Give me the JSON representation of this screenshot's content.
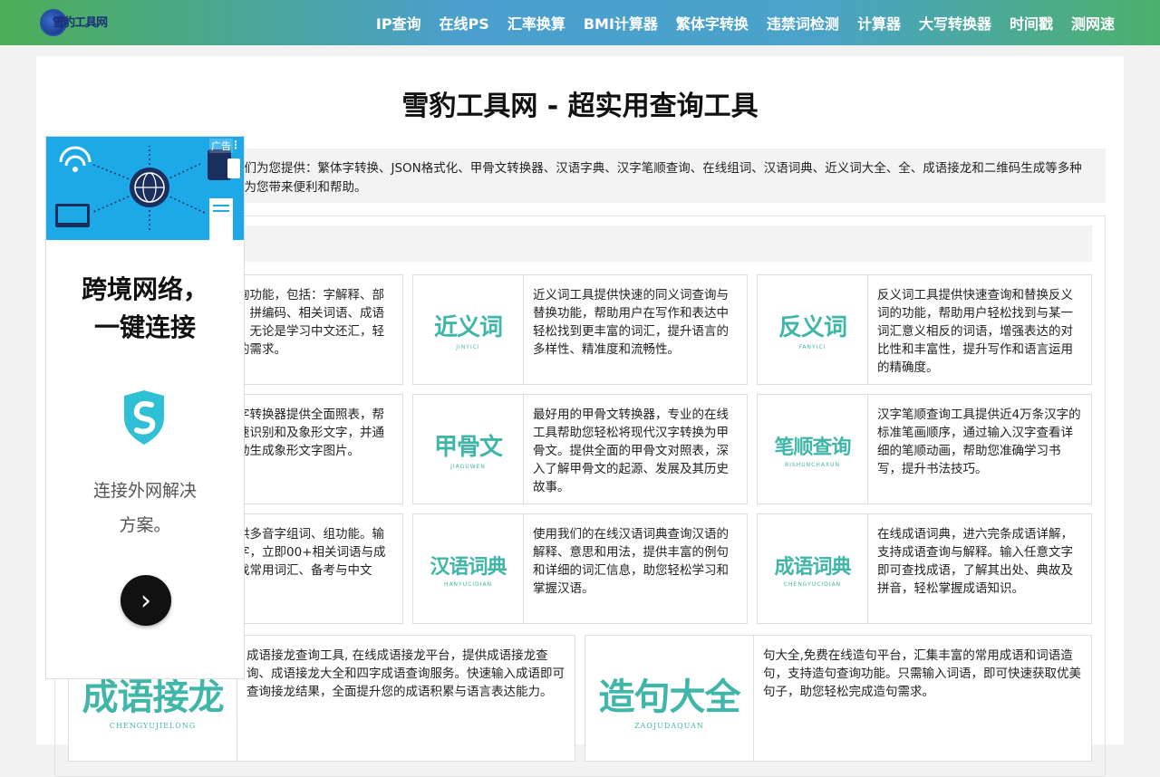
{
  "header": {
    "logo_text": "雪豹工具网",
    "nav": [
      "IP查询",
      "在线PS",
      "汇率换算",
      "BMI计算器",
      "繁体字转换",
      "违禁词检测",
      "计算器",
      "大写转换器",
      "时间戳",
      "测网速"
    ]
  },
  "main": {
    "title": "雪豹工具网 - 超实用查询工具",
    "intro": "提供便捷的在线查询服务。我们为您提供：繁体字转换、JSON格式化、甲骨文转换器、汉语字典、汉字笔顺查询、在线组词、汉语词典、近义词大全、全、成语接龙和二维码生成等多种工具，我们希望这些工具能够为您带来便利和帮助。",
    "cards": [
      {
        "thumb": "",
        "thumb_sub": "",
        "desc": "的详细查询功能，包括：字解释、部首、笔画、拼编码、相关词语、成语组翻译等。无论是学习中文还汇，轻松满足您的需求。"
      },
      {
        "thumb": "近义词",
        "thumb_sub": "JINYICI",
        "desc": "近义词工具提供快速的同义词查询与替换功能，帮助用户在写作和表达中轻松找到更丰富的词汇，提升语言的多样性、精准度和流畅性。"
      },
      {
        "thumb": "反义词",
        "thumb_sub": "FANYICI",
        "desc": "反义词工具提供快速查询和替换反义词的功能，帮助用户轻松找到与某一词汇意义相反的词语，增强表达的对比性和丰富性，提升写作和语言运用的精确度。"
      },
      {
        "thumb": "",
        "thumb_sub": "",
        "desc": "及象形文字转换器提供全面照表，帮助用户快速识别和及象形文字，并通过输入现动生成象形文字图片。"
      },
      {
        "thumb": "甲骨文",
        "thumb_sub": "JIAGUWEN",
        "desc": "最好用的甲骨文转换器，专业的在线工具帮助您轻松将现代汉字转换为甲骨文。提供全面的甲骨文对照表，深入了解甲骨文的起源、发展及其历史故事。"
      },
      {
        "thumb": "笔顺查询",
        "thumb_sub": "BISHUNCHAXUN",
        "desc": "汉字笔顺查询工具提供近4万条汉字的标准笔画顺序，通过输入汉字查看详细的笔顺动画，帮助您准确学习书写，提升书法技巧。"
      },
      {
        "thumb": "",
        "thumb_sub": "",
        "desc": "工具，提供多音字组词、组功能。输入任意汉字，立即00+相关词语与成语，帮查找常用词汇、备考与中文"
      },
      {
        "thumb": "汉语词典",
        "thumb_sub": "HANYUCIDIAN",
        "desc": "使用我们的在线汉语词典查询汉语的解释、意思和用法，提供丰富的例句和详细的词汇信息，助您轻松学习和掌握汉语。"
      },
      {
        "thumb": "成语词典",
        "thumb_sub": "CHENGYUCIDIAN",
        "desc": "在线成语词典，进六完条成语详解，支持成语查询与解释。输入任意文字即可查找成语，了解其出处、典故及拼音，轻松掌握成语知识。"
      }
    ],
    "wide_cards": [
      {
        "thumb": "成语接龙",
        "thumb_sub": "CHENGYUJIELONG",
        "desc": "成语接龙查询工具, 在线成语接龙平台，提供成语接龙查询、成语接龙大全和四字成语查询服务。快速输入成语即可查询接龙结果，全面提升您的成语积累与语言表达能力。"
      },
      {
        "thumb": "造句大全",
        "thumb_sub": "ZAOJUDAQUAN",
        "desc": "句大全,免费在线造句平台，汇集丰富的常用成语和词语造句，支持造句查询功能。只需输入词语，即可快速获取优美句子，助您轻松完成造句需求。"
      }
    ]
  },
  "ad": {
    "label": "广告",
    "headline": "跨境网络，一键连接",
    "sub": "连接外网解决方案。",
    "button_icon": "›"
  }
}
